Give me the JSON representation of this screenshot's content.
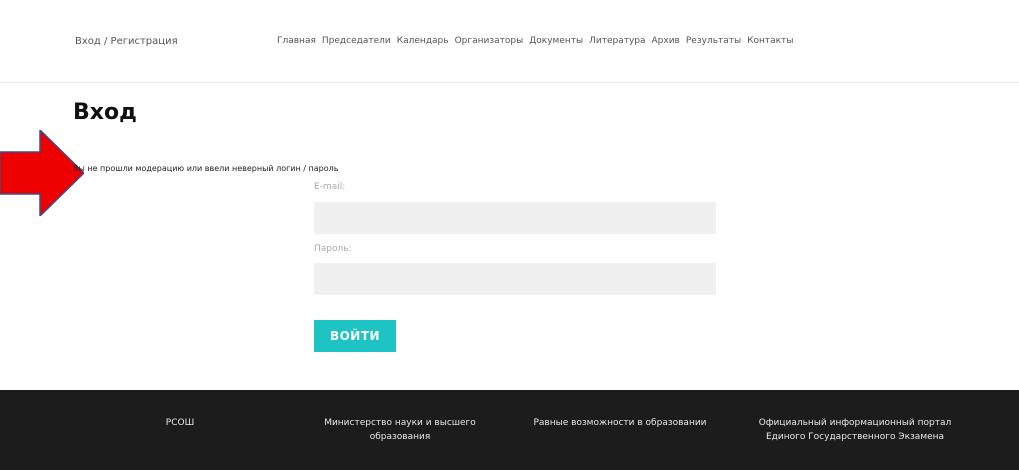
{
  "header": {
    "login_link": "Вход / Регистрация",
    "nav": [
      "Главная",
      "Председатели",
      "Календарь",
      "Организаторы",
      "Документы",
      "Литература",
      "Архив",
      "Результаты",
      "Контакты"
    ]
  },
  "main": {
    "title": "Вход",
    "error": "Вы не прошли модерацию или ввели неверный логин / пароль",
    "email_label": "E-mail:",
    "email_value": "",
    "password_label": "Пароль:",
    "password_value": "",
    "submit_label": "ВОЙТИ"
  },
  "footer": {
    "links": [
      "РСОШ",
      "Министерство науки и высшего образования",
      "Равные возможности в образовании",
      "Официальный информационный портал Единого Государственного Экзамена"
    ]
  },
  "colors": {
    "accent": "#1ec3c3",
    "footer_bg": "#1c1c1c",
    "arrow": "#ee0000"
  },
  "icons": {
    "annotation": "red-arrow-icon"
  }
}
